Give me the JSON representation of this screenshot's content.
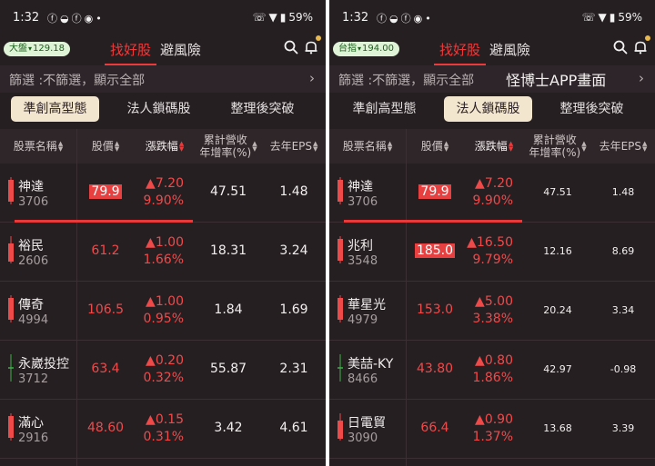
{
  "panels": [
    {
      "status": {
        "time": "1:32",
        "battery": "59%"
      },
      "market_badge": {
        "label": "大盤",
        "arrow": "▾",
        "value": "129.18"
      },
      "tabs": [
        "找好股",
        "避風險"
      ],
      "filter_text": "篩選 :不篩選，顯示全部",
      "overlay_title": "",
      "subtabs": [
        "準創高型態",
        "法人鎖碼股",
        "整理後突破"
      ],
      "active_subtab": 0,
      "headers": {
        "name": "股票名稱",
        "price": "股價",
        "change": "漲跌幅",
        "rev_l1": "累計營收",
        "rev_l2": "年增率(%)",
        "eps": "去年EPS"
      },
      "small_numbers": false,
      "rows": [
        {
          "name": "神達",
          "code": "3706",
          "price": "79.9",
          "highlight": true,
          "change": "▲7.20",
          "pct": "9.90%",
          "rev": "47.51",
          "eps": "1.48",
          "candle": "full"
        },
        {
          "name": "裕民",
          "code": "2606",
          "price": "61.2",
          "highlight": false,
          "change": "▲1.00",
          "pct": "1.66%",
          "rev": "18.31",
          "eps": "3.24",
          "candle": "wick"
        },
        {
          "name": "傳奇",
          "code": "4994",
          "price": "106.5",
          "highlight": false,
          "change": "▲1.00",
          "pct": "0.95%",
          "rev": "1.84",
          "eps": "1.69",
          "candle": "full"
        },
        {
          "name": "永崴投控",
          "code": "3712",
          "price": "63.4",
          "highlight": false,
          "change": "▲0.20",
          "pct": "0.32%",
          "rev": "55.87",
          "eps": "2.31",
          "candle": "cross"
        },
        {
          "name": "滿心",
          "code": "2916",
          "price": "48.60",
          "highlight": false,
          "change": "▲0.15",
          "pct": "0.31%",
          "rev": "3.42",
          "eps": "4.61",
          "candle": "full"
        }
      ]
    },
    {
      "status": {
        "time": "1:32",
        "battery": "59%"
      },
      "market_badge": {
        "label": "台指",
        "arrow": "▾",
        "value": "194.00"
      },
      "tabs": [
        "找好股",
        "避風險"
      ],
      "filter_text": "篩選 :不篩選，顯示全部",
      "overlay_title": "怪博士APP畫面",
      "subtabs": [
        "準創高型態",
        "法人鎖碼股",
        "整理後突破"
      ],
      "active_subtab": 1,
      "headers": {
        "name": "股票名稱",
        "price": "股價",
        "change": "漲跌幅",
        "rev_l1": "累計營收",
        "rev_l2": "年增率(%)",
        "eps": "去年EPS"
      },
      "small_numbers": true,
      "rows": [
        {
          "name": "神達",
          "code": "3706",
          "price": "79.9",
          "highlight": true,
          "change": "▲7.20",
          "pct": "9.90%",
          "rev": "47.51",
          "eps": "1.48",
          "candle": "full"
        },
        {
          "name": "兆利",
          "code": "3548",
          "price": "185.0",
          "highlight": true,
          "change": "▲16.50",
          "pct": "9.79%",
          "rev": "12.16",
          "eps": "8.69",
          "candle": "full"
        },
        {
          "name": "華星光",
          "code": "4979",
          "price": "153.0",
          "highlight": false,
          "change": "▲5.00",
          "pct": "3.38%",
          "rev": "20.24",
          "eps": "3.34",
          "candle": "full"
        },
        {
          "name": "美喆-KY",
          "code": "8466",
          "price": "43.80",
          "highlight": false,
          "change": "▲0.80",
          "pct": "1.86%",
          "rev": "42.97",
          "eps": "-0.98",
          "candle": "cross"
        },
        {
          "name": "日電貿",
          "code": "3090",
          "price": "66.4",
          "highlight": false,
          "change": "▲0.90",
          "pct": "1.37%",
          "rev": "13.68",
          "eps": "3.39",
          "candle": "wick"
        }
      ]
    }
  ],
  "colors": {
    "background": "#261f22",
    "up_red": "#ef4a4a",
    "active_tab": "#ec3a3a",
    "subtab_active_bg": "#f3e6cf",
    "badge_bg": "#dff4d7"
  },
  "icons": [
    "facebook-icon",
    "messenger-icon",
    "line-icon",
    "wifi-icon",
    "battery-icon",
    "search-icon",
    "bell-icon",
    "chevron-right-icon"
  ]
}
